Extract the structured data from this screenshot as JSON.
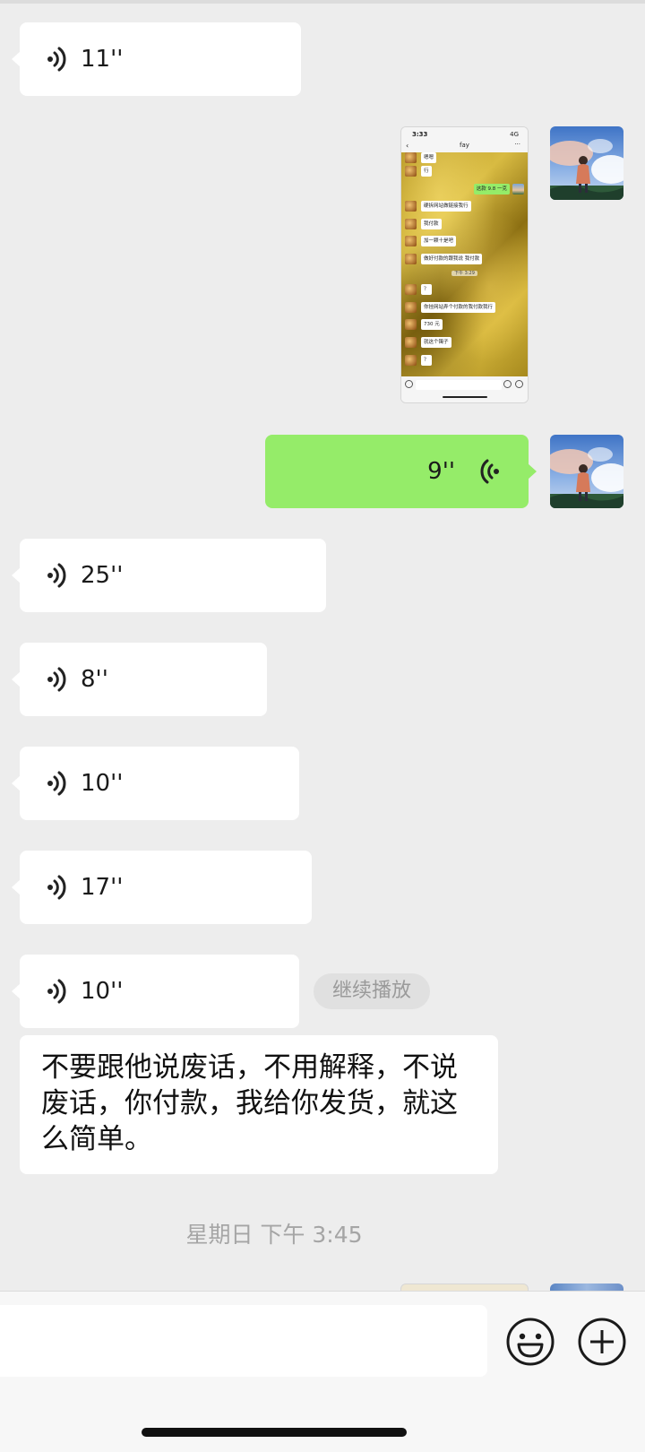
{
  "colors": {
    "background": "#ededed",
    "incoming_bubble": "#ffffff",
    "outgoing_bubble": "#95ec69",
    "timestamp_text": "#a5a5a5"
  },
  "messages": {
    "voice_in_1": "11''",
    "voice_out_1": "9''",
    "voice_in_2": "25''",
    "voice_in_3": "8''",
    "voice_in_4": "10''",
    "voice_in_5": "17''",
    "voice_in_6": "10''",
    "continue_play": "继续播放",
    "text_in_1": "不要跟他说废话，不用解释，不说废话，你付款，我给你发货，就这么简单。",
    "timestamp": "星期日 下午 3:45"
  },
  "screenshot": {
    "status_time": "3:33",
    "status_signal": "4G",
    "chat_name": "fay",
    "rows": [
      {
        "side": "in",
        "text": "嗯嗯"
      },
      {
        "side": "in",
        "text": "行"
      },
      {
        "side": "out",
        "text": "这款 9.8 一克"
      },
      {
        "side": "in",
        "text": "硬拆网站做链接我行"
      },
      {
        "side": "in",
        "text": "我付款"
      },
      {
        "side": "in",
        "text": "加一颗十是吧"
      },
      {
        "side": "in",
        "text": "做好付款的跟我说 我付款"
      },
      {
        "side": "stamp",
        "text": "下午 3:29"
      },
      {
        "side": "in",
        "text": "？"
      },
      {
        "side": "in",
        "text": "你挂网站弄个付款的我付款我行"
      },
      {
        "side": "in",
        "text": "730 元"
      },
      {
        "side": "in",
        "text": "就这个镯子"
      },
      {
        "side": "in",
        "text": "？"
      }
    ]
  },
  "icons": {
    "voice_in": "voice-wave-icon",
    "voice_out": "voice-wave-icon",
    "emoji": "emoji-icon",
    "plus": "plus-icon"
  }
}
